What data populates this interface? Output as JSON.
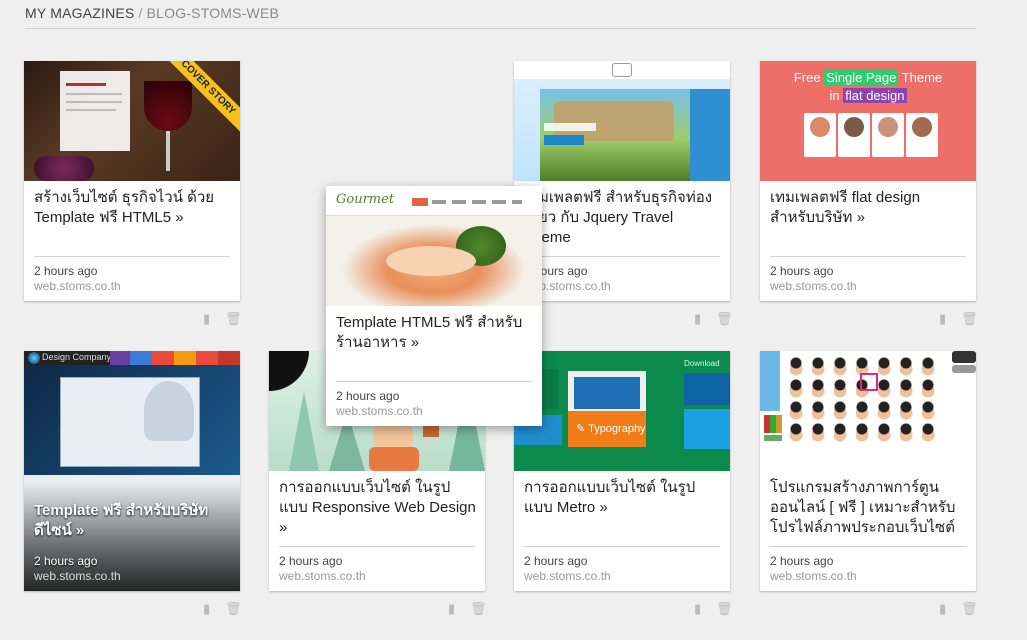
{
  "breadcrumb": {
    "root": "MY MAGAZINES",
    "sep": "/",
    "current": "BLOG-STOMS-WEB"
  },
  "cards": [
    {
      "title": "สร้างเว็บไซต์ ธุรกิจไวน์ ด้วย Template ฟรี HTML5 »",
      "time": "2 hours ago",
      "source": "web.stoms.co.th",
      "badge": "COVER STORY"
    },
    {
      "title": "Template HTML5 ฟรี สำหรับร้านอาหาร »",
      "time": "2 hours ago",
      "source": "web.stoms.co.th",
      "thumb_label": "Gourmet"
    },
    {
      "title": "เทมเพลตฟรี สำหรับธุรกิจท่องเที่ยว กับ Jquery Travel Theme",
      "time": "2 hours ago",
      "source": "web.stoms.co.th"
    },
    {
      "title": "เทมเพลตฟรี flat design สำหรับบริษัท »",
      "time": "2 hours ago",
      "source": "web.stoms.co.th",
      "thumb_text_1": "Free",
      "thumb_hl_1": "Single Page",
      "thumb_text_2": "Theme",
      "thumb_text_3": "in",
      "thumb_hl_2": "flat design"
    },
    {
      "title": "Template ฟรี สำหรับบริษัท ดีไซน์ »",
      "time": "2 hours ago",
      "source": "web.stoms.co.th",
      "thumb_label": "Design Company"
    },
    {
      "title": "การออกแบบเว็บไซต์ ในรูปแบบ Responsive Web Design »",
      "time": "2 hours ago",
      "source": "web.stoms.co.th"
    },
    {
      "title": "การออกแบบเว็บไซต์ ในรูปแบบ Metro »",
      "time": "2 hours ago",
      "source": "web.stoms.co.th",
      "tile_label": "Typography",
      "tile_label_2": "Download"
    },
    {
      "title": "โปรแกรมสร้างภาพการ์ตูนออนไลน์ [ ฟรี ] เหมาะสำหรับโปรไฟล์ภาพประกอบเว็บไซต์",
      "time": "2 hours ago",
      "source": "web.stoms.co.th"
    }
  ],
  "icons": {
    "read": "reader-icon",
    "delete": "trash-icon"
  },
  "colors": {
    "accent_yellow": "#f6c21a",
    "flat_red": "#ee6e69",
    "flat_green": "#2ecc71",
    "flat_purple": "#8e44ad",
    "metro_green": "#0b8a4c"
  }
}
